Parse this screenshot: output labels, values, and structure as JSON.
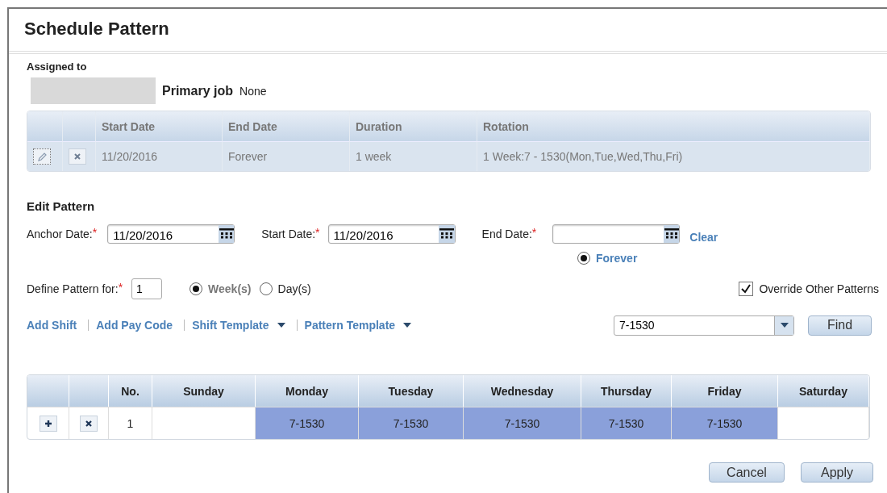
{
  "window": {
    "title": "Schedule Pattern"
  },
  "assigned": {
    "label": "Assigned to",
    "primary_job_label": "Primary job",
    "primary_job": "None"
  },
  "patterns_table": {
    "columns": [
      "Start Date",
      "End Date",
      "Duration",
      "Rotation"
    ],
    "rows": [
      {
        "cells": [
          "11/20/2016",
          "Forever",
          "1 week",
          "1 Week:7 - 1530(Mon,Tue,Wed,Thu,Fri)"
        ]
      }
    ]
  },
  "edit": {
    "title": "Edit Pattern",
    "dates": [
      {
        "label": "Anchor Date:",
        "required_mark": "*",
        "value": "11/20/2016"
      },
      {
        "label": "Start Date:",
        "required_mark": "*",
        "value": "11/20/2016"
      },
      {
        "label": "End Date:",
        "required_mark": "*"
      }
    ],
    "clear_link": "Clear",
    "forever": {
      "label": "Forever",
      "selected": true
    },
    "define": {
      "label": "Define Pattern for:",
      "required_mark": "*",
      "value": "1"
    },
    "units": [
      {
        "label": "Week(s)",
        "selected": true
      },
      {
        "label": "Day(s)",
        "selected": false
      }
    ],
    "override": {
      "label": "Override Other Patterns",
      "checked": true
    },
    "actions": [
      {
        "label": "Add Shift",
        "kind": "link"
      },
      {
        "label": "Add Pay Code",
        "kind": "link"
      },
      {
        "label": "Shift Template",
        "kind": "menu"
      },
      {
        "label": "Pattern Template",
        "kind": "menu"
      }
    ],
    "search": {
      "value": "7-1530"
    },
    "find_button": "Find"
  },
  "grid": {
    "columns": [
      "No.",
      "Sunday",
      "Monday",
      "Tuesday",
      "Wednesday",
      "Thursday",
      "Friday",
      "Saturday"
    ],
    "rows": [
      {
        "no": "1",
        "days": [
          {
            "filled": false
          },
          {
            "shift": "7-1530",
            "filled": true
          },
          {
            "shift": "7-1530",
            "filled": true
          },
          {
            "shift": "7-1530",
            "filled": true
          },
          {
            "shift": "7-1530",
            "filled": true
          },
          {
            "shift": "7-1530",
            "filled": true
          },
          {
            "filled": false
          }
        ]
      }
    ]
  },
  "buttons": [
    "Cancel",
    "Apply"
  ]
}
